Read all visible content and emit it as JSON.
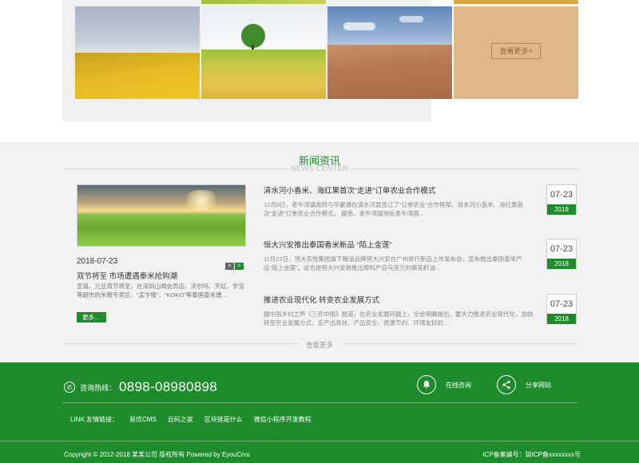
{
  "gallery": {
    "more_label": "查看更多+"
  },
  "news": {
    "title": "新闻资讯",
    "subtitle": "NEWS CENTER",
    "featured": {
      "date": "2018-07-23",
      "prev_icon": "arrow-left-icon",
      "next_icon": "arrow-right-icon",
      "prev": "<",
      "next": ">",
      "title": "双节将至 市场遭遇泰米抢购潮",
      "excerpt": "圣诞、元旦双节将至，在深圳山姆会员店、沃尔玛、天虹、岁宝等超市的米粮专卖区，“孟乍隆”、“KOKO”等泰国香米遭...",
      "more": "更多..."
    },
    "items": [
      {
        "title": "清水河小香米、海红果首次“走进”订单农业合作模式",
        "excerpt": "12月8日，老牛湾镇政府与华蒙通在清水河县签订了“订单农业”合作框架，清水河小香米、海红果首次“走进”订单农业合作模式。    据悉，老牛湾镇地处老牛湾国...",
        "md": "07-23",
        "year": "2018"
      },
      {
        "title": "恒大兴安推出泰国香米新品 “陌上金莲”",
        "excerpt": "11月22日，恒大农牧集团旗下粮油品牌恒大兴安在广州举行新品上市发布会，宣布推出泰国香米产品“陌上金莲”。这也是恒大兴安继推出原料产自乌克兰的葵花籽油...",
        "md": "07-23",
        "year": "2018"
      },
      {
        "title": "推进农业现代化 转变农业发展方式",
        "excerpt": "据中国乡村之声《三农中国》报道，在农业发展问题上，全会明确提出，要大力推进农业现代化，加快转变农业发展方式，走产出高效、产品安全、资源节约、环境友好的...",
        "md": "07-23",
        "year": "2018"
      }
    ],
    "view_more": "查看更多"
  },
  "footer": {
    "phone_icon": "phone-icon",
    "hotline_label": "咨询热线：",
    "hotline_number": "0898-08980898",
    "online_icon": "chat-bell-icon",
    "online_label": "在线咨询",
    "share_icon": "share-icon",
    "share_label": "分享网站",
    "links_label": "LINK 友情链接：",
    "links": [
      "易优CMS",
      "云码之家",
      "区块链是什么",
      "微信小程序开发教程"
    ],
    "copyright": "Copyright © 2012-2018 某某公司 版权所有 Powered by EyouCms",
    "icp": "ICP备案编号：琼ICP备xxxxxxxx号"
  },
  "colors": {
    "brand_green": "#1e8b2c",
    "gallery_more_bg": "#deb887"
  }
}
